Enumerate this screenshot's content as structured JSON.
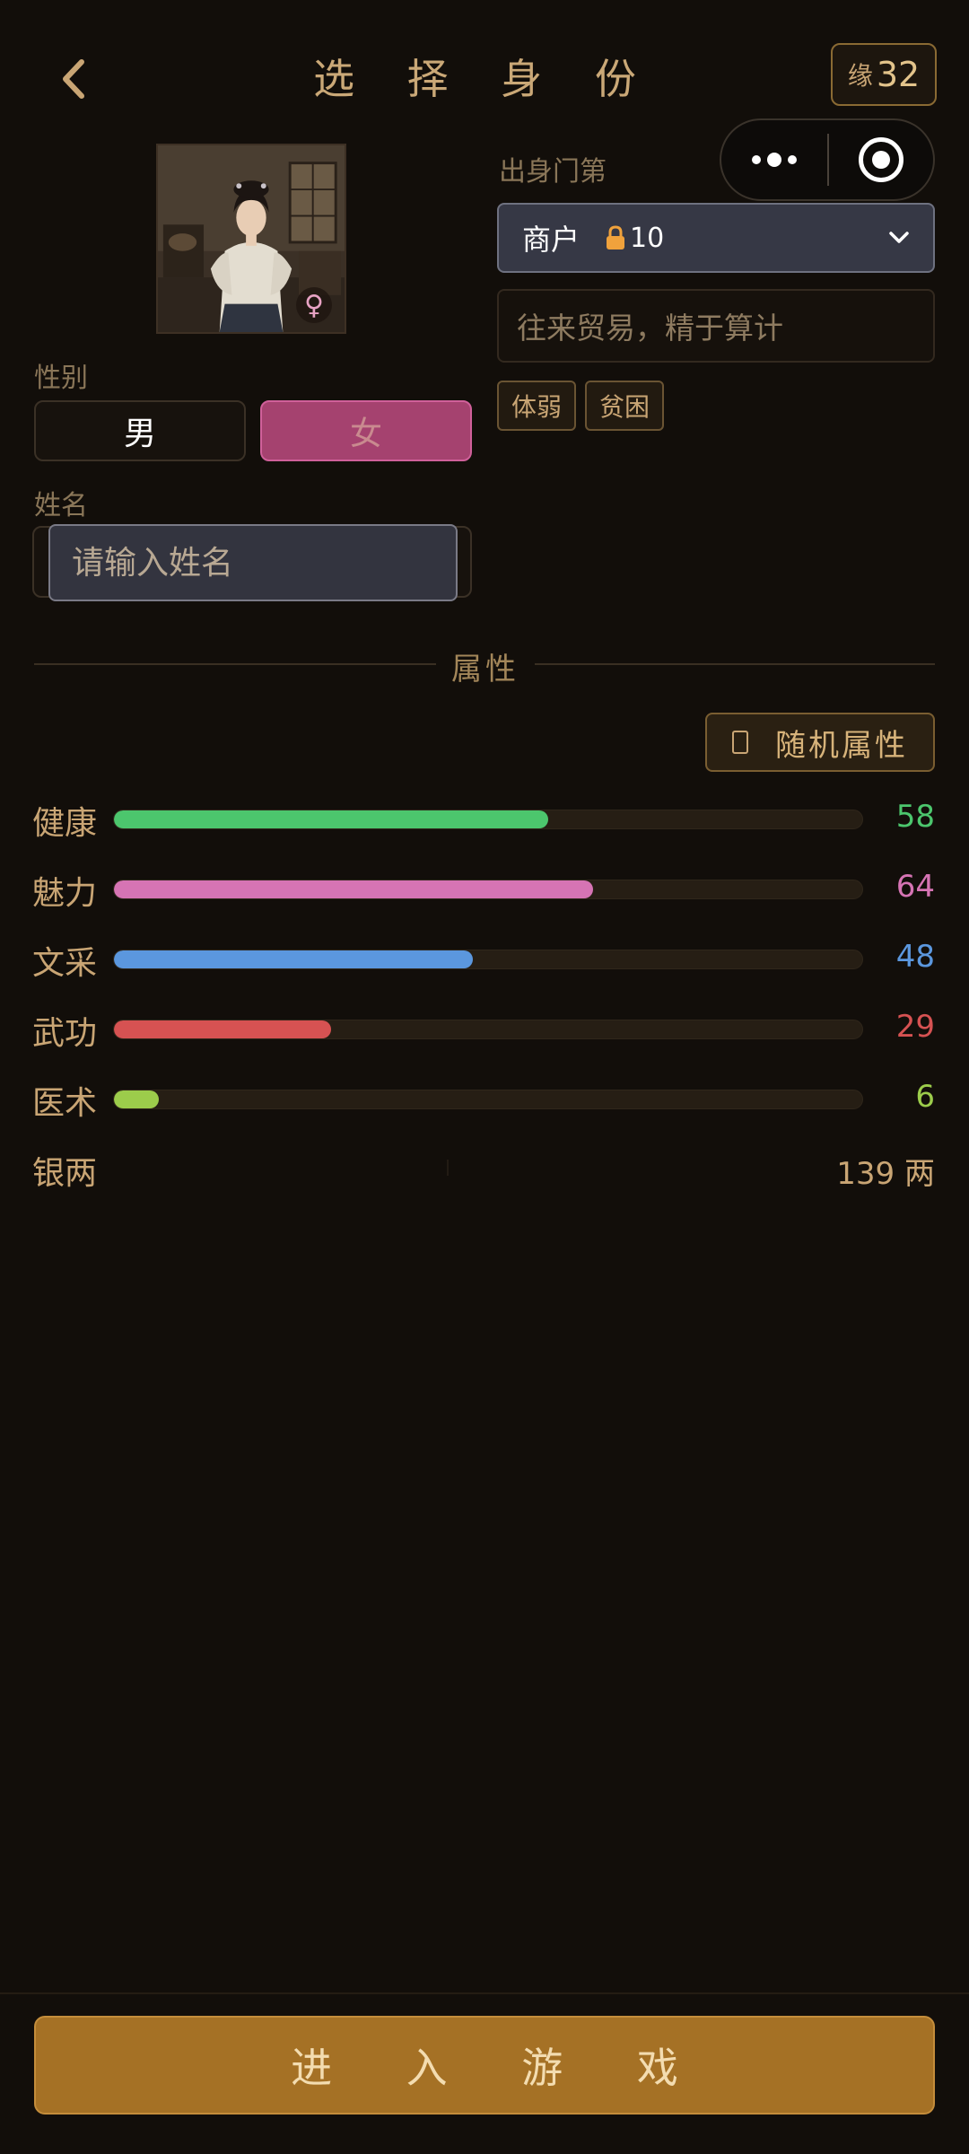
{
  "header": {
    "title": "选 择 身 份",
    "yuan_label": "缘",
    "yuan_value": "32"
  },
  "portrait": {
    "gender_symbol": "♀"
  },
  "gender": {
    "label": "性别",
    "male": "男",
    "female": "女",
    "selected": "female"
  },
  "name": {
    "label": "姓名",
    "placeholder": "请输入姓名"
  },
  "origin": {
    "label": "出身门第",
    "selected": "商户",
    "lock_cost": "10",
    "description": "往来贸易，精于算计",
    "traits": [
      "体弱",
      "贫困"
    ]
  },
  "attributes": {
    "title": "属性",
    "random_label": "随机属性",
    "stats": [
      {
        "name": "健康",
        "value": "58",
        "fraction": 0.58,
        "color": "#4cc66d"
      },
      {
        "name": "魅力",
        "value": "64",
        "fraction": 0.64,
        "color": "#d674b4"
      },
      {
        "name": "文采",
        "value": "48",
        "fraction": 0.48,
        "color": "#5b97de"
      },
      {
        "name": "武功",
        "value": "29",
        "fraction": 0.29,
        "color": "#d65252"
      },
      {
        "name": "医术",
        "value": "6",
        "fraction": 0.06,
        "color": "#9ccc4b"
      }
    ],
    "silver_label": "银两",
    "silver_value": "139 两"
  },
  "footer": {
    "enter_label": "进 入 游 戏"
  }
}
